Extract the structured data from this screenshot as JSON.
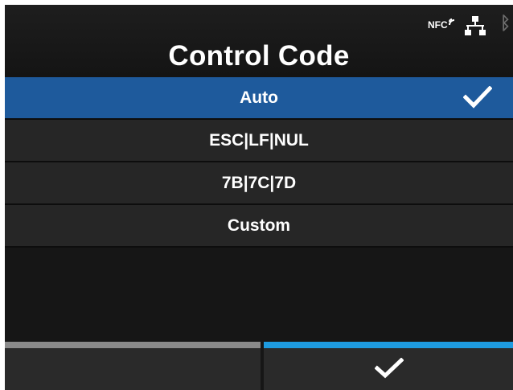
{
  "header": {
    "title": "Control Code",
    "status": {
      "nfc_label": "NFC"
    }
  },
  "menu": {
    "items": [
      {
        "label": "Auto",
        "selected": true
      },
      {
        "label": "ESC|LF|NUL",
        "selected": false
      },
      {
        "label": "7B|7C|7D",
        "selected": false
      },
      {
        "label": "Custom",
        "selected": false
      }
    ]
  },
  "softkeys": {
    "left": {
      "icon": "empty"
    },
    "right": {
      "icon": "checkmark-icon"
    }
  },
  "colors": {
    "selected_row": "#1e5a9c",
    "row": "#262626",
    "left_softkey_bar": "#8a8a8a",
    "right_softkey_bar": "#1e9be0"
  }
}
